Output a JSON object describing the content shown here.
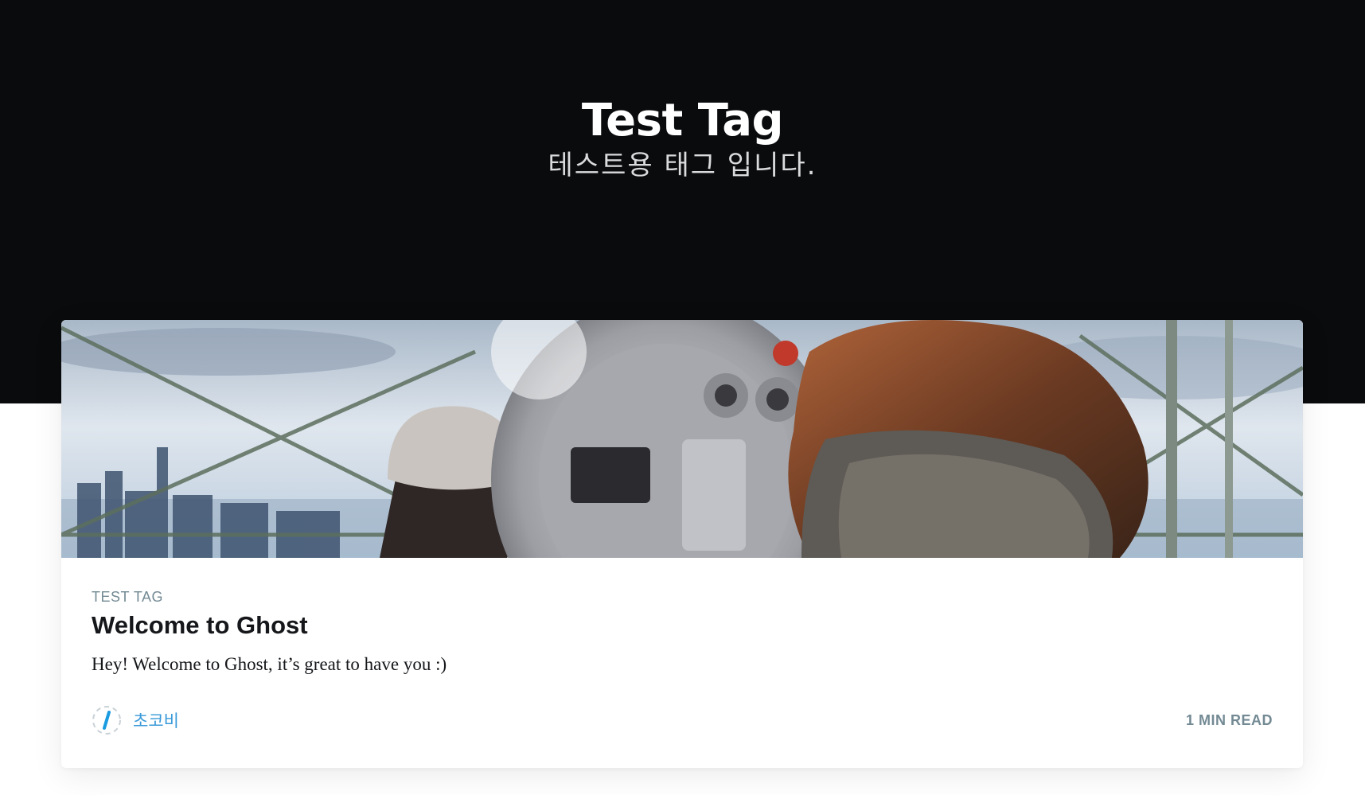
{
  "header": {
    "title": "Test Tag",
    "description": "테스트용 태그 입니다."
  },
  "post": {
    "tag": "TEST TAG",
    "title": "Welcome to Ghost",
    "excerpt": "Hey! Welcome to Ghost, it’s great to have you :)",
    "author_name": "초코비",
    "reading_time": "1 MIN READ",
    "feature_image_alt": "person looking through coin-operated binoculars at a city skyline"
  },
  "colors": {
    "hero_bg": "#0a0b0d",
    "accent": "#3a9ad9",
    "meta_gray": "#738a94"
  },
  "icons": {
    "avatar": "author-avatar-icon"
  }
}
